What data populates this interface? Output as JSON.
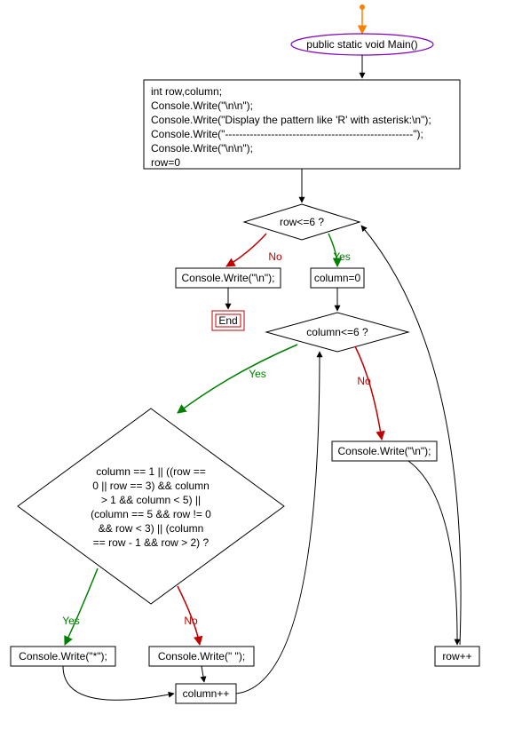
{
  "start": {
    "label": "public static void Main()"
  },
  "init": {
    "l1": "int row,column;",
    "l2": "Console.Write(\"\\n\\n\");",
    "l3": "Console.Write(\"Display the pattern like 'R' with asterisk:\\n\");",
    "l4": "Console.Write(\"-----------------------------------------------------\");",
    "l5": "Console.Write(\"\\n\\n\");",
    "l6": "row=0"
  },
  "dec_row": {
    "cond": "row<=6 ?",
    "yes": "Yes",
    "no": "No"
  },
  "row_no_box": "Console.Write(\"\\n\");",
  "end_label": "End",
  "col_init": "column=0",
  "dec_col": {
    "cond": "column<=6 ?",
    "yes": "Yes",
    "no": "No"
  },
  "col_no_box": "Console.Write(\"\\n\");",
  "big_cond": {
    "l1": "column == 1 || ((row ==",
    "l2": "0 || row == 3) && column",
    "l3": "> 1 && column < 5) ||",
    "l4": "(column == 5 && row != 0",
    "l5": "&& row < 3) || (column",
    "l6": "== row - 1 && row > 2) ?"
  },
  "big_yes": "Yes",
  "big_no": "No",
  "write_star": "Console.Write(\"*\");",
  "write_space": "Console.Write(\" \");",
  "col_inc": "column++",
  "row_inc": "row++"
}
